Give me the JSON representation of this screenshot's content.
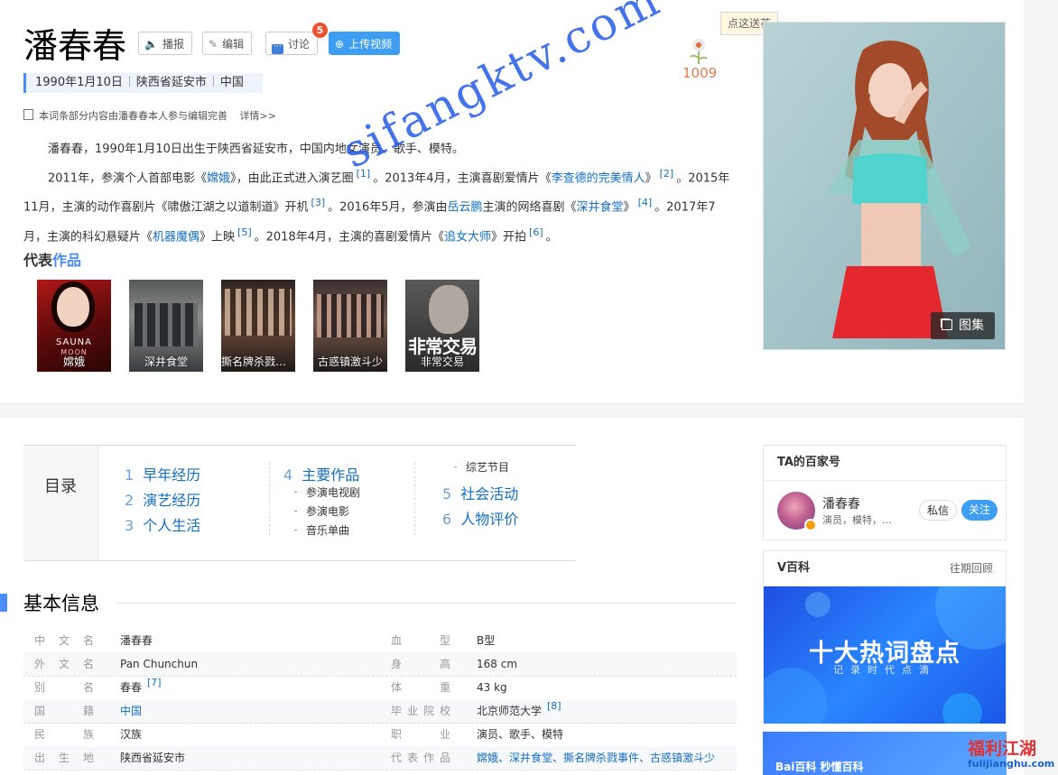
{
  "header": {
    "title": "潘春春",
    "buttons": {
      "play": "播报",
      "edit": "编辑",
      "discuss": "讨论",
      "discuss_badge": "5",
      "upload": "上传视频"
    },
    "flower": {
      "tip": "点这送花",
      "count": "1009"
    },
    "tagline": [
      "1990年1月10日",
      "陕西省延安市",
      "中国"
    ],
    "note": "本词条部分内容由潘春春本人参与编辑完善",
    "note_link": "详情>>"
  },
  "summary": {
    "p1": "潘春春，1990年1月10日出生于陕西省延安市，中国内地女演员、歌手、模特。",
    "p2": [
      {
        "t": "2011年，参演个人首部电影《"
      },
      {
        "l": "嫦娥"
      },
      {
        "t": "》，由此正式进入演艺圈"
      },
      {
        "s": "[1]"
      },
      {
        "t": "。2013年4月，主演喜剧爱情片《"
      },
      {
        "l": "李查德的完美情人"
      },
      {
        "t": "》"
      },
      {
        "s": "[2]"
      },
      {
        "t": "。2015年11月，主演的动作喜剧片《啸傲江湖之以道制道》开机"
      },
      {
        "s": "[3]"
      },
      {
        "t": "。2016年5月，参演由"
      },
      {
        "l": "岳云鹏"
      },
      {
        "t": "主演的网络喜剧《"
      },
      {
        "l": "深井食堂"
      },
      {
        "t": "》"
      },
      {
        "s": "[4]"
      },
      {
        "t": "。2017年7月，主演的科幻悬疑片《"
      },
      {
        "l": "机器魔偶"
      },
      {
        "t": "》上映"
      },
      {
        "s": "[5]"
      },
      {
        "t": "。2018年4月，主演的喜剧爱情片《"
      },
      {
        "l": "追女大师"
      },
      {
        "t": "》开拍"
      },
      {
        "s": "[6]"
      },
      {
        "t": "。"
      }
    ]
  },
  "works": {
    "title_a": "代表",
    "title_b": "作品",
    "items": [
      "嫦娥",
      "深井食堂",
      "撕名牌杀戮事件",
      "古惑镇激斗少",
      "非常交易"
    ],
    "poster_texts": [
      "SAUNA",
      "MOON",
      "非常交易"
    ]
  },
  "hero": {
    "gallery_label": "图集"
  },
  "toc": {
    "label": "目录",
    "items": [
      {
        "num": "1",
        "label": "早年经历"
      },
      {
        "num": "2",
        "label": "演艺经历"
      },
      {
        "num": "3",
        "label": "个人生活"
      },
      {
        "num": "4",
        "label": "主要作品"
      },
      {
        "num": "5",
        "label": "社会活动"
      },
      {
        "num": "6",
        "label": "人物评价"
      }
    ],
    "subs": [
      "参演电视剧",
      "参演电影",
      "音乐单曲",
      "综艺节目"
    ]
  },
  "basic": {
    "title": "基本信息",
    "rows": [
      {
        "k1": "中文名",
        "v1": "潘春春",
        "k2": "血　型",
        "v2": "B型"
      },
      {
        "k1": "外文名",
        "v1": "Pan Chunchun",
        "k2": "身　高",
        "v2": "168 cm"
      },
      {
        "k1": "别　名",
        "v1": "春春",
        "s1": "[7]",
        "k2": "体　重",
        "v2": "43 kg"
      },
      {
        "k1": "国　籍",
        "v1": "中国",
        "k2": "毕业院校",
        "v2": "北京师范大学",
        "s2": "[8]"
      },
      {
        "k1": "民　族",
        "v1": "汉族",
        "k2": "职　业",
        "v2": "演员、歌手、模特"
      },
      {
        "k1": "出生地",
        "v1": "陕西省延安市",
        "k2": "代表作品",
        "v2": "嫦娥、深井食堂、撕名牌杀戮事件、古惑镇激斗少"
      }
    ]
  },
  "baijia": {
    "title": "TA的百家号",
    "name": "潘春春",
    "desc": "演员，模特，...",
    "msg": "私信",
    "follow": "关注"
  },
  "vbaike": {
    "title": "V百科",
    "more": "往期回顾",
    "banner_title": "十大热词盘点",
    "banner_sub": "记录时代点滴"
  },
  "banner2": {
    "logo": "Bai百科 秒懂百科"
  },
  "watermark": "sifangktv.com",
  "corner_logo": {
    "line1": "福利江湖",
    "line2": "fulijianghu.com"
  },
  "colors": {
    "accent": "#4b8df8",
    "link": "#136ec2",
    "primary_button": "#3e9ef3",
    "badge": "#f0502e"
  }
}
